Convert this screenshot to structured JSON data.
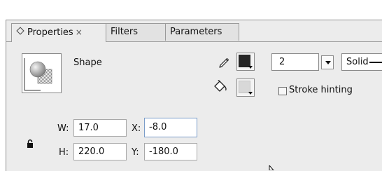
{
  "tabs": [
    {
      "label": "Properties",
      "close": "×"
    },
    {
      "label": "Filters"
    },
    {
      "label": "Parameters"
    }
  ],
  "object": {
    "type_label": "Shape",
    "icon": "shape-preview-icon"
  },
  "stroke": {
    "icon": "pencil-icon",
    "color": "#262626",
    "width": "2",
    "style": "Solid"
  },
  "fill": {
    "icon": "paint-bucket-icon",
    "color": "#d8d8d8"
  },
  "stroke_hinting": {
    "label": "Stroke hinting",
    "checked": false
  },
  "dimensions": {
    "w_label": "W:",
    "w": "17.0",
    "h_label": "H:",
    "h": "220.0",
    "x_label": "X:",
    "x": "-8.0",
    "y_label": "Y:",
    "y": "-180.0",
    "lock_icon": "lock-icon"
  },
  "colors": {
    "panel_bg": "#ececec",
    "tab_bg": "#e2e2e2",
    "focus_border": "#7a9cc9"
  }
}
